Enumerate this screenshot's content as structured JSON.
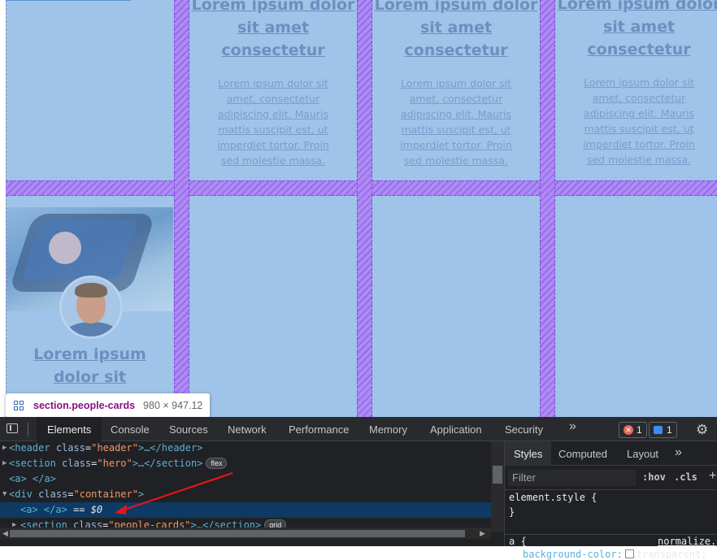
{
  "page": {
    "cards_top": [
      {
        "title": "Lorem ipsum dolor sit amet consectetur",
        "text": "Lorem ipsum dolor sit amet, consectetur adipiscing elit. Mauris mattis suscipit est, ut imperdiet tortor. Proin sed molestie massa."
      },
      {
        "title": "Lorem ipsum dolor sit amet consectetur",
        "text": "Lorem ipsum dolor sit amet, consectetur adipiscing elit. Mauris mattis suscipit est, ut imperdiet tortor. Proin sed molestie massa."
      },
      {
        "title": "Lorem ipsum dolor sit amet consectetur",
        "text": "Lorem ipsum dolor sit amet, consectetur adipiscing elit. Mauris mattis suscipit est, ut imperdiet tortor. Proin sed molestie massa."
      }
    ],
    "card_bottom": {
      "title": "Lorem ipsum dolor sit amet"
    },
    "overlay_color": "#a0c3e9",
    "grid_gap_color": "#9868ee"
  },
  "tooltip": {
    "selector": "section.people-cards",
    "size": "980 × 947.12"
  },
  "devtools": {
    "tabs": [
      "Elements",
      "Console",
      "Sources",
      "Network",
      "Performance",
      "Memory",
      "Application",
      "Security"
    ],
    "active_tab": "Elements",
    "more": "»",
    "error_count": "1",
    "message_count": "1",
    "tree": [
      {
        "open": "<header",
        "attr": "class",
        "val": "\"header\"",
        "rest": ">…</header>"
      },
      {
        "open": "<section",
        "attr": "class",
        "val": "\"hero\"",
        "rest": ">…</section>",
        "pill": "flex"
      },
      {
        "text": "<a> </a>"
      },
      {
        "open": "<div",
        "attr": "class",
        "val": "\"container\"",
        "rest": ">"
      },
      {
        "text": "<a> </a>",
        "marker": "== $0"
      },
      {
        "open": "<section",
        "attr": "class",
        "val": "\"people-cards\"",
        "rest": ">…</section>",
        "pill": "grid"
      }
    ],
    "side_tabs": [
      "Styles",
      "Computed",
      "Layout"
    ],
    "side_active": "Styles",
    "filter_placeholder": "Filter",
    "hov": ":hov",
    "cls": ".cls",
    "plus": "+",
    "element_style_open": "element.style {",
    "element_style_close": "}",
    "a_rule_open": "a {",
    "a_rule_source": "normalize.",
    "a_rule_prop": "background-color:",
    "a_rule_val": "transparent;"
  }
}
